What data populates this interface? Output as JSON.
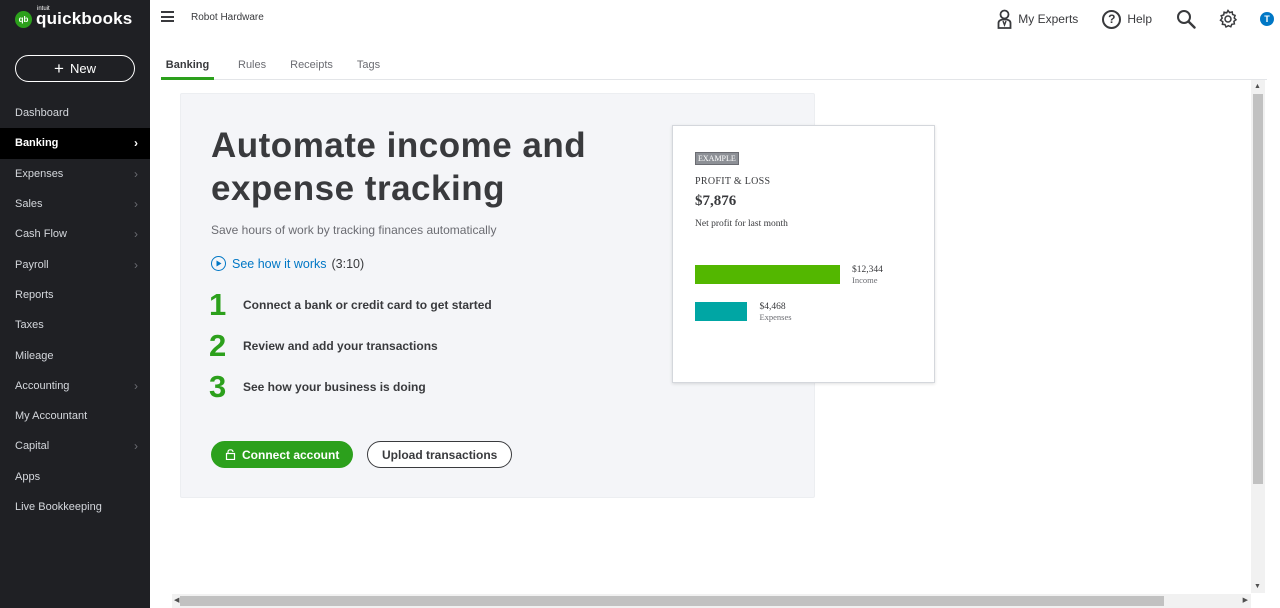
{
  "app": {
    "logo_small": "intuit",
    "logo_text": "quickbooks",
    "logo_badge": "qb"
  },
  "sidebar": {
    "new_label": "New",
    "items": [
      {
        "label": "Dashboard",
        "chevron": false,
        "active": false
      },
      {
        "label": "Banking",
        "chevron": true,
        "active": true
      },
      {
        "label": "Expenses",
        "chevron": true,
        "active": false
      },
      {
        "label": "Sales",
        "chevron": true,
        "active": false
      },
      {
        "label": "Cash Flow",
        "chevron": true,
        "active": false
      },
      {
        "label": "Payroll",
        "chevron": true,
        "active": false
      },
      {
        "label": "Reports",
        "chevron": false,
        "active": false
      },
      {
        "label": "Taxes",
        "chevron": false,
        "active": false
      },
      {
        "label": "Mileage",
        "chevron": false,
        "active": false
      },
      {
        "label": "Accounting",
        "chevron": true,
        "active": false
      },
      {
        "label": "My Accountant",
        "chevron": false,
        "active": false
      },
      {
        "label": "Capital",
        "chevron": true,
        "active": false
      },
      {
        "label": "Apps",
        "chevron": false,
        "active": false
      },
      {
        "label": "Live Bookkeeping",
        "chevron": false,
        "active": false
      }
    ]
  },
  "header": {
    "company_name": "Robot Hardware",
    "my_experts_label": "My Experts",
    "help_label": "Help",
    "help_icon_glyph": "?",
    "avatar_initial": "T"
  },
  "tabs": [
    {
      "label": "Banking",
      "active": true
    },
    {
      "label": "Rules",
      "active": false
    },
    {
      "label": "Receipts",
      "active": false
    },
    {
      "label": "Tags",
      "active": false
    }
  ],
  "main": {
    "headline": "Automate income and expense tracking",
    "subhead": "Save hours of work by tracking finances automatically",
    "video_label": "See how it works",
    "video_duration": "(3:10)",
    "steps": [
      {
        "num": "1",
        "text": "Connect a bank or credit card to get started"
      },
      {
        "num": "2",
        "text": "Review and add your transactions"
      },
      {
        "num": "3",
        "text": "See how your business is doing"
      }
    ],
    "connect_button": "Connect account",
    "upload_button": "Upload transactions"
  },
  "example": {
    "badge": "EXAMPLE",
    "title": "PROFIT & LOSS",
    "value": "$7,876",
    "subtitle": "Net profit for last month",
    "income": {
      "amount": "$12,344",
      "label": "Income",
      "value": 12344,
      "color": "#53b700"
    },
    "expenses": {
      "amount": "$4,468",
      "label": "Expenses",
      "value": 4468,
      "color": "#00a6a4"
    }
  },
  "colors": {
    "accent_green": "#2ca01c",
    "link_blue": "#0077c5",
    "sidebar_bg": "#1f2024"
  }
}
